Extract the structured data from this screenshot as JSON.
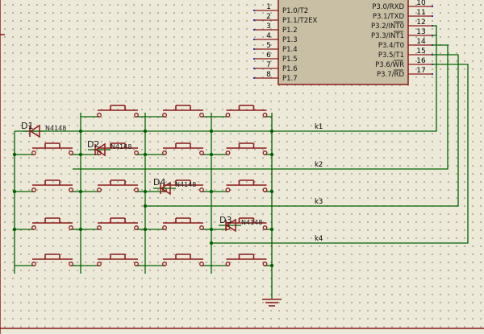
{
  "chip": {
    "left_pins": [
      {
        "num": "1",
        "label": "P1.0/T2"
      },
      {
        "num": "2",
        "label": "P1.1/T2EX"
      },
      {
        "num": "3",
        "label": "P1.2"
      },
      {
        "num": "4",
        "label": "P1.3"
      },
      {
        "num": "5",
        "label": "P1.4"
      },
      {
        "num": "6",
        "label": "P1.5"
      },
      {
        "num": "7",
        "label": "P1.6"
      },
      {
        "num": "8",
        "label": "P1.7"
      }
    ],
    "right_pins": [
      {
        "num": "10",
        "label": "P3.0/RXD"
      },
      {
        "num": "11",
        "label": "P3.1/TXD"
      },
      {
        "num": "12",
        "label": "P3.2/INT0"
      },
      {
        "num": "13",
        "label": "P3.3/INT1"
      },
      {
        "num": "14",
        "label": "P3.4/T0"
      },
      {
        "num": "15",
        "label": "P3.5/T1"
      },
      {
        "num": "16",
        "label": "P3.6/WR"
      },
      {
        "num": "17",
        "label": "P3.7/RD"
      }
    ]
  },
  "diodes": [
    {
      "ref": "D1",
      "value": "N4148"
    },
    {
      "ref": "D2",
      "value": "N4148"
    },
    {
      "ref": "D4",
      "value": "N4148"
    },
    {
      "ref": "D3",
      "value": "N4148"
    }
  ],
  "net_labels": [
    "k1",
    "k2",
    "k3",
    "k4"
  ],
  "colors": {
    "wire": "#006400",
    "component": "#8b1a1a",
    "chip_fill": "#c9bfa5",
    "pin_end": "#1f3fb0",
    "junction": "#006400"
  }
}
